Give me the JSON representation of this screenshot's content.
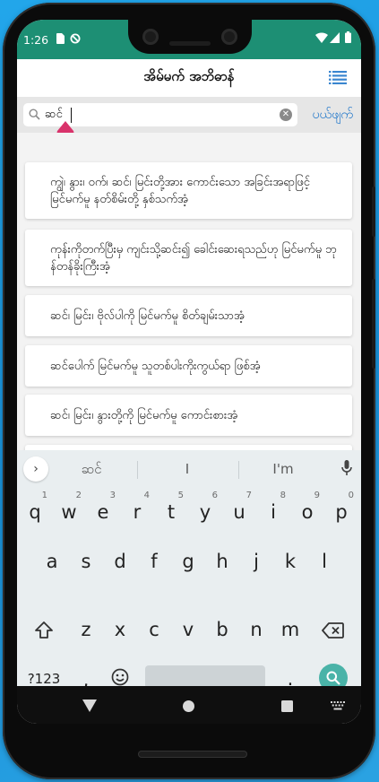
{
  "status_bar": {
    "time": "1:26",
    "icons": [
      "sim-card-icon",
      "data-saver-icon",
      "wifi-icon",
      "signal-icon",
      "battery-icon"
    ]
  },
  "header": {
    "title": "အိမ်မက် အဘိဓာန်",
    "menu_icon": "list-menu-icon"
  },
  "search": {
    "value": "ဆင်",
    "cancel_label": "ပယ်ဖျက်",
    "clear_icon": "clear-icon",
    "search_icon": "search-icon"
  },
  "results": [
    {
      "text": "ကျွဲ၊ နွား၊ ဝက်၊ ဆင်၊ မြင်းတို့အား ကောင်းသော အခြင်းအရာဖြင့် မြင်မက်မူ နတ်စိမ်းတို့ နှစ်သက်အံ့"
    },
    {
      "text": "ကုန်းကိုတက်ပြီးမှ ကျင်းသို့ဆင်း၍ ခေါင်းဆေးရသည်ဟု မြင်မက်မူ ဘုန်တန်ခိုးကြီးအံ့"
    },
    {
      "text": "ဆင်၊ မြင်း၊ ဗိုလ်ပါကို မြင်မက်မူ စိတ်ချမ်းသာအံ့"
    },
    {
      "text": "ဆင်ပေါက် မြင်မက်မူ သူတစ်ပါးကိုးကွယ်ရာ ဖြစ်အံ့"
    },
    {
      "text": "ဆင်၊ မြင်း၊ နွားတို့ကို မြင်မက်မူ ကောင်းစားအံ့"
    }
  ],
  "keyboard": {
    "suggestions": [
      "ဆင်",
      "I",
      "I'm"
    ],
    "row1": [
      {
        "key": "q",
        "hint": "1"
      },
      {
        "key": "w",
        "hint": "2"
      },
      {
        "key": "e",
        "hint": "3"
      },
      {
        "key": "r",
        "hint": "4"
      },
      {
        "key": "t",
        "hint": "5"
      },
      {
        "key": "y",
        "hint": "6"
      },
      {
        "key": "u",
        "hint": "7"
      },
      {
        "key": "i",
        "hint": "8"
      },
      {
        "key": "o",
        "hint": "9"
      },
      {
        "key": "p",
        "hint": "0"
      }
    ],
    "row2": [
      "a",
      "s",
      "d",
      "f",
      "g",
      "h",
      "j",
      "k",
      "l"
    ],
    "row3": [
      "z",
      "x",
      "c",
      "v",
      "b",
      "n",
      "m"
    ],
    "symbols_label": "?123",
    "comma_label": ",",
    "period_label": ".",
    "shift_icon": "shift-icon",
    "backspace_icon": "backspace-icon",
    "emoji_icon": "emoji-icon",
    "enter_icon": "search-enter-icon",
    "mic_icon": "microphone-icon",
    "expand_icon": "chevron-right-icon"
  },
  "navbar": {
    "icons": [
      "back-icon",
      "home-icon",
      "recents-icon",
      "keyboard-switch-icon"
    ]
  },
  "colors": {
    "status_bar": "#1d8f74",
    "accent": "#1a73c9",
    "enter_key": "#4ab3a8",
    "drag_handle": "#d9336b"
  }
}
